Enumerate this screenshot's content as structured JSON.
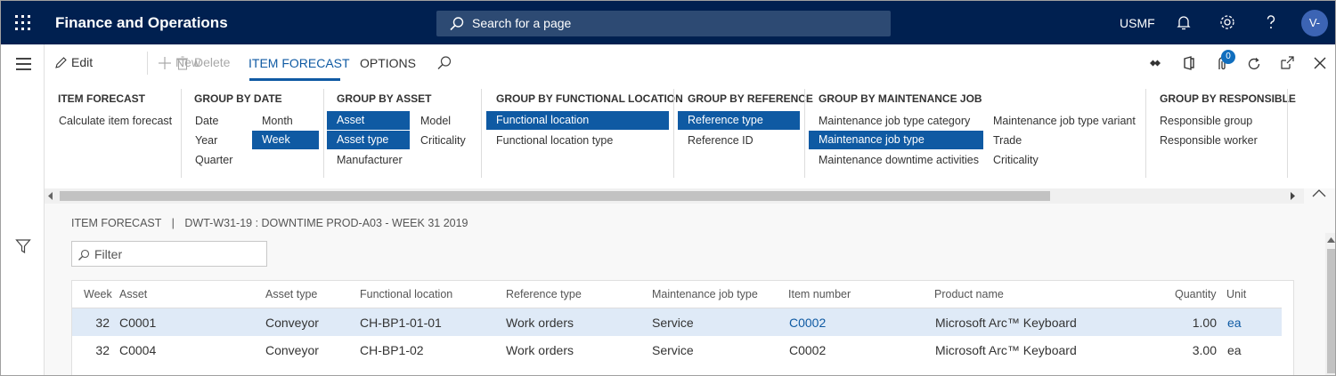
{
  "topbar": {
    "app_title": "Finance and Operations",
    "search_placeholder": "Search for a page",
    "company": "USMF",
    "avatar_initials": "V-"
  },
  "actionbar": {
    "edit": "Edit",
    "new": "New",
    "delete": "Delete",
    "tabs": [
      "ITEM FORECAST",
      "OPTIONS"
    ],
    "attachments_count": "0"
  },
  "ribbon": {
    "groups": [
      {
        "title": "ITEM FORECAST",
        "items": [
          "Calculate item forecast"
        ]
      },
      {
        "title": "GROUP BY DATE",
        "items": [
          "Date",
          "Month",
          "Year",
          "Week",
          "Quarter"
        ],
        "selected": [
          "Week"
        ]
      },
      {
        "title": "GROUP BY ASSET",
        "items": [
          "Asset",
          "Model",
          "Asset type",
          "Criticality",
          "Manufacturer"
        ],
        "selected": [
          "Asset",
          "Asset type"
        ]
      },
      {
        "title": "GROUP BY FUNCTIONAL LOCATION",
        "items": [
          "Functional location",
          "Functional location type"
        ],
        "selected": [
          "Functional location"
        ]
      },
      {
        "title": "GROUP BY REFERENCE",
        "items": [
          "Reference type",
          "Reference ID"
        ],
        "selected": [
          "Reference type"
        ]
      },
      {
        "title": "GROUP BY MAINTENANCE JOB",
        "items": [
          "Maintenance job type category",
          "Maintenance job type variant",
          "Maintenance job type",
          "Trade",
          "Maintenance downtime activities",
          "Criticality"
        ],
        "selected": [
          "Maintenance job type"
        ]
      },
      {
        "title": "GROUP BY RESPONSIBLE",
        "items": [
          "Responsible group",
          "Responsible worker"
        ]
      }
    ]
  },
  "content": {
    "caption_left": "ITEM FORECAST",
    "caption_sep": "|",
    "caption_right": "DWT-W31-19 : DOWNTIME PROD-A03 - WEEK 31 2019",
    "filter_placeholder": "Filter"
  },
  "grid": {
    "columns": [
      "Week",
      "Asset",
      "Asset type",
      "Functional location",
      "Reference type",
      "Maintenance job type",
      "Item number",
      "Product name",
      "Quantity",
      "Unit"
    ],
    "rows": [
      [
        "32",
        "C0001",
        "Conveyor",
        "CH-BP1-01-01",
        "Work orders",
        "Service",
        "C0002",
        "Microsoft Arc™ Keyboard",
        "1.00",
        "ea"
      ],
      [
        "32",
        "C0004",
        "Conveyor",
        "CH-BP1-02",
        "Work orders",
        "Service",
        "C0002",
        "Microsoft Arc™ Keyboard",
        "3.00",
        "ea"
      ]
    ]
  },
  "colors": {
    "topbar": "#002050",
    "accent": "#0f5aa3",
    "selected_row": "#dfeaf7"
  }
}
